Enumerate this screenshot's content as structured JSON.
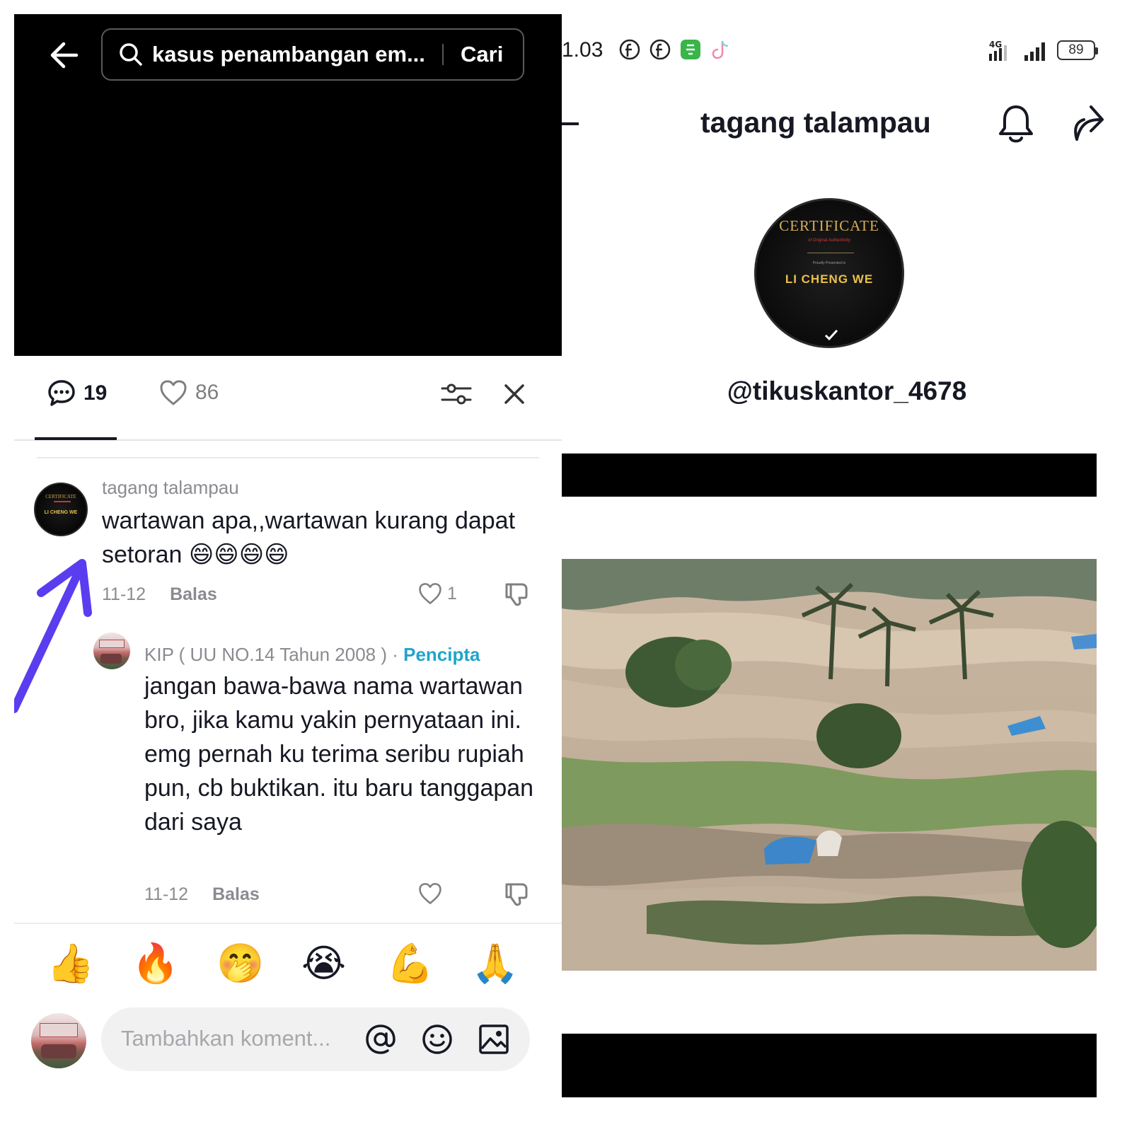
{
  "search": {
    "query": "kasus penambangan em...",
    "button_label": "Cari"
  },
  "tabs": {
    "comments_count": "19",
    "likes_count": "86"
  },
  "comments": [
    {
      "username": "tagang talampau",
      "text": "wartawan apa,,wartawan kurang dapat setoran 😄😄😄😄",
      "date": "11-12",
      "reply_label": "Balas",
      "likes": "1"
    },
    {
      "username": "KIP ( UU NO.14 Tahun 2008 ) ·",
      "creator_badge": "Pencipta",
      "text": "jangan bawa-bawa nama wartawan bro, jika kamu yakin pernyataan ini. emg pernah ku terima seribu rupiah pun, cb buktikan. itu baru tanggapan dari saya",
      "date": "11-12",
      "reply_label": "Balas",
      "likes": ""
    }
  ],
  "quick_emojis": [
    "👍",
    "🔥",
    "🤭",
    "😭",
    "💪",
    "🙏"
  ],
  "comment_input": {
    "placeholder": "Tambahkan koment..."
  },
  "status_bar": {
    "time": "1.03",
    "network": "4G",
    "battery": "89"
  },
  "profile": {
    "name": "tagang talampau",
    "handle": "@tikuskantor_4678",
    "avatar_text": {
      "title": "CERTIFICATE",
      "subtitle": "of Original Authenticity",
      "presented": "Proudly Presented to",
      "name": "LI CHENG WE"
    }
  },
  "colors": {
    "creator_badge": "#20a5c9",
    "annotation_arrow": "#5b3df0",
    "text_primary": "#161823",
    "text_secondary": "#8a8b91"
  }
}
